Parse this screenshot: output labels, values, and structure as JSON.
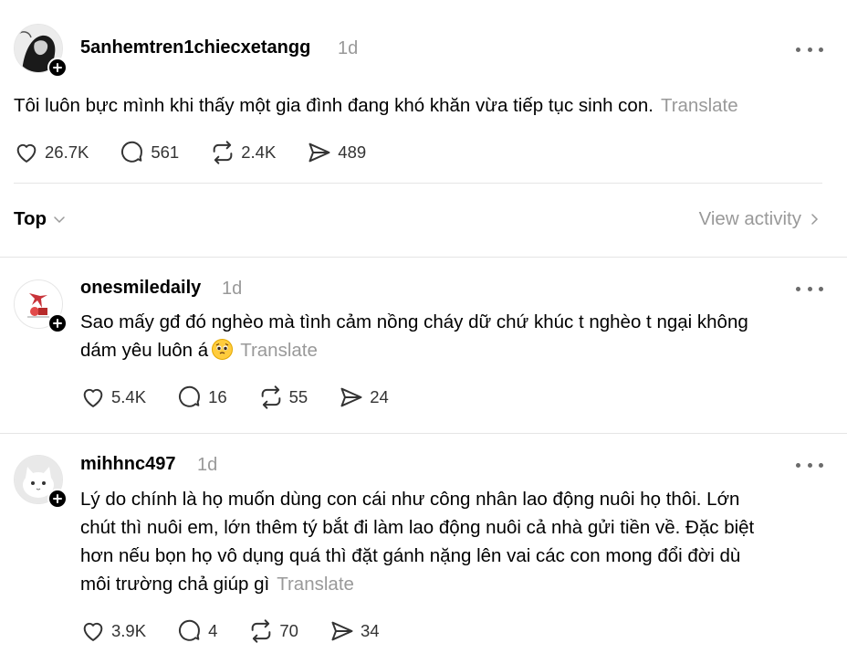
{
  "main_post": {
    "username": "5anhemtren1chiecxetangg",
    "time": "1d",
    "text": "Tôi luôn bực mình khi thấy một gia đình đang khó khăn vừa tiếp tục sinh con.",
    "translate": "Translate",
    "likes": "26.7K",
    "replies": "561",
    "reposts": "2.4K",
    "shares": "489"
  },
  "sort": {
    "label": "Top",
    "view_activity": "View activity"
  },
  "comments": [
    {
      "username": "onesmiledaily",
      "time": "1d",
      "text_line1": "Sao mấy gđ đó nghèo mà tình cảm nồng cháy dữ chứ khúc t nghèo t ngại không",
      "text_line2": "dám yêu luôn á",
      "translate": "Translate",
      "likes": "5.4K",
      "replies": "16",
      "reposts": "55",
      "shares": "24"
    },
    {
      "username": "mihhnc497",
      "time": "1d",
      "text_line1": "Lý do chính là họ muốn dùng con cái như công nhân lao động nuôi họ thôi. Lớn",
      "text_line2": "chút thì nuôi em, lớn thêm tý bắt đi làm lao động nuôi cả nhà gửi tiền về. Đặc biệt",
      "text_line3": "hơn nếu bọn họ vô dụng quá thì đặt gánh nặng lên vai các con mong đổi đời dù",
      "text_line4": "môi trường chả giúp gì",
      "translate": "Translate",
      "likes": "3.9K",
      "replies": "4",
      "reposts": "70",
      "shares": "34"
    }
  ],
  "colors": {
    "text": "#000000",
    "muted": "#999999",
    "divider": "#e5e5e5",
    "icon": "#333333"
  }
}
